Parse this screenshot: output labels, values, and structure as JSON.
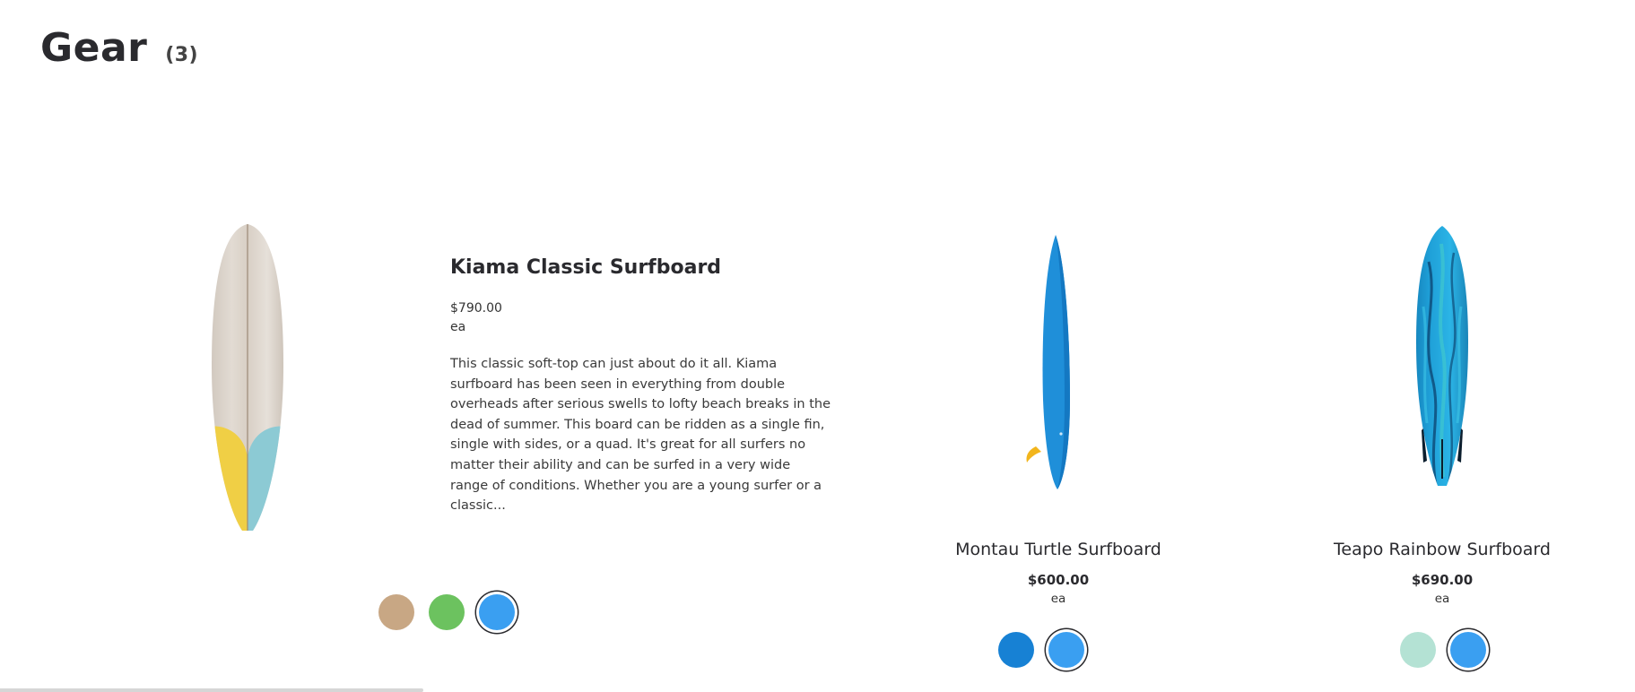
{
  "page": {
    "title": "Gear",
    "count": "(3)"
  },
  "featured": {
    "name": "Kiama Classic Surfboard",
    "price": "$790.00",
    "unit": "ea",
    "description": "This classic soft-top can just about do it all. Kiama surfboard has been seen in everything from double overheads after serious swells to lofty beach breaks in the dead of summer. This board can be ridden as a single fin, single with sides, or a quad. It's great for all surfers no matter their ability and can be surfed in a very wide range of conditions. Whether you are a young surfer or a classic...",
    "swatches": [
      {
        "color": "#c8a784",
        "selected": false
      },
      {
        "color": "#6cc25f",
        "selected": false
      },
      {
        "color": "#3a9ff1",
        "selected": true
      }
    ]
  },
  "products": [
    {
      "name": "Montau Turtle Surfboard",
      "price": "$600.00",
      "unit": "ea",
      "swatches": [
        {
          "color": "#1781d4",
          "selected": false
        },
        {
          "color": "#3a9ff1",
          "selected": true
        }
      ]
    },
    {
      "name": "Teapo Rainbow Surfboard",
      "price": "$690.00",
      "unit": "ea",
      "swatches": [
        {
          "color": "#b4e2d4",
          "selected": false
        },
        {
          "color": "#3a9ff1",
          "selected": true
        }
      ]
    }
  ]
}
